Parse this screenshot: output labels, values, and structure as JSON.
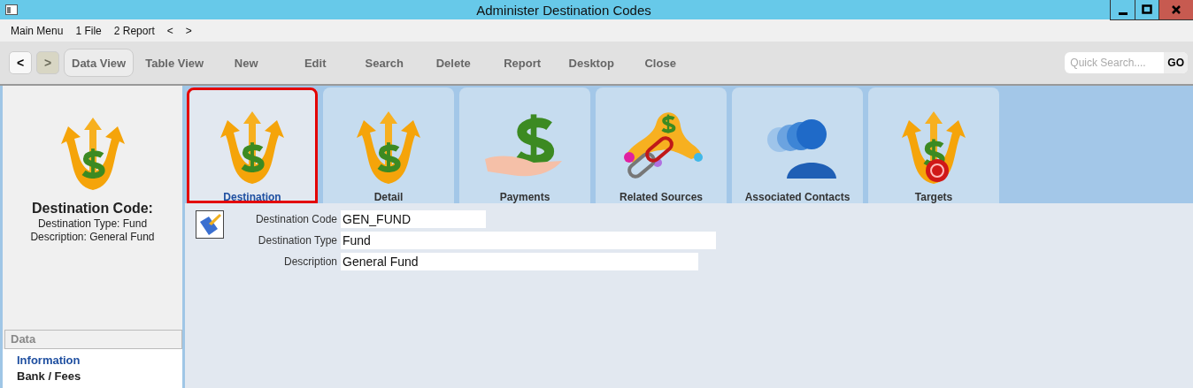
{
  "window": {
    "title": "Administer Destination Codes"
  },
  "menu": [
    "Main Menu",
    "1 File",
    "2 Report",
    "<",
    ">"
  ],
  "nav": [
    {
      "label": "<",
      "disabled": false
    },
    {
      "label": ">",
      "disabled": true
    }
  ],
  "toolbar": [
    {
      "label": "Data View",
      "selected": true
    },
    {
      "label": "Table View",
      "selected": false
    },
    {
      "label": "New",
      "selected": false
    },
    {
      "label": "Edit",
      "selected": false
    },
    {
      "label": "Search",
      "selected": false
    },
    {
      "label": "Delete",
      "selected": false
    },
    {
      "label": "Report",
      "selected": false
    },
    {
      "label": "Desktop",
      "selected": false
    },
    {
      "label": "Close",
      "selected": false
    }
  ],
  "quick_search": {
    "placeholder": "Quick Search....",
    "button": "GO"
  },
  "summary": {
    "title": "Destination Code:",
    "lines": [
      "Destination Type: Fund",
      "Description: General Fund"
    ]
  },
  "sidebar": {
    "header": "Data",
    "items": [
      {
        "label": "Information",
        "selected": true
      },
      {
        "label": "Bank / Fees",
        "selected": false
      }
    ]
  },
  "tabs": [
    {
      "label": "Destination",
      "kind": "destination",
      "selected": true
    },
    {
      "label": "Detail",
      "kind": "destination",
      "selected": false
    },
    {
      "label": "Payments",
      "kind": "payments",
      "selected": false
    },
    {
      "label": "Related Sources",
      "kind": "links",
      "selected": false
    },
    {
      "label": "Associated Contacts",
      "kind": "contacts",
      "selected": false
    },
    {
      "label": "Targets",
      "kind": "targets",
      "selected": false
    }
  ],
  "fields": [
    {
      "label": "Destination Code",
      "value": "GEN_FUND"
    },
    {
      "label": "Destination Type",
      "value": "Fund"
    },
    {
      "label": "Description",
      "value": "General Fund"
    }
  ]
}
